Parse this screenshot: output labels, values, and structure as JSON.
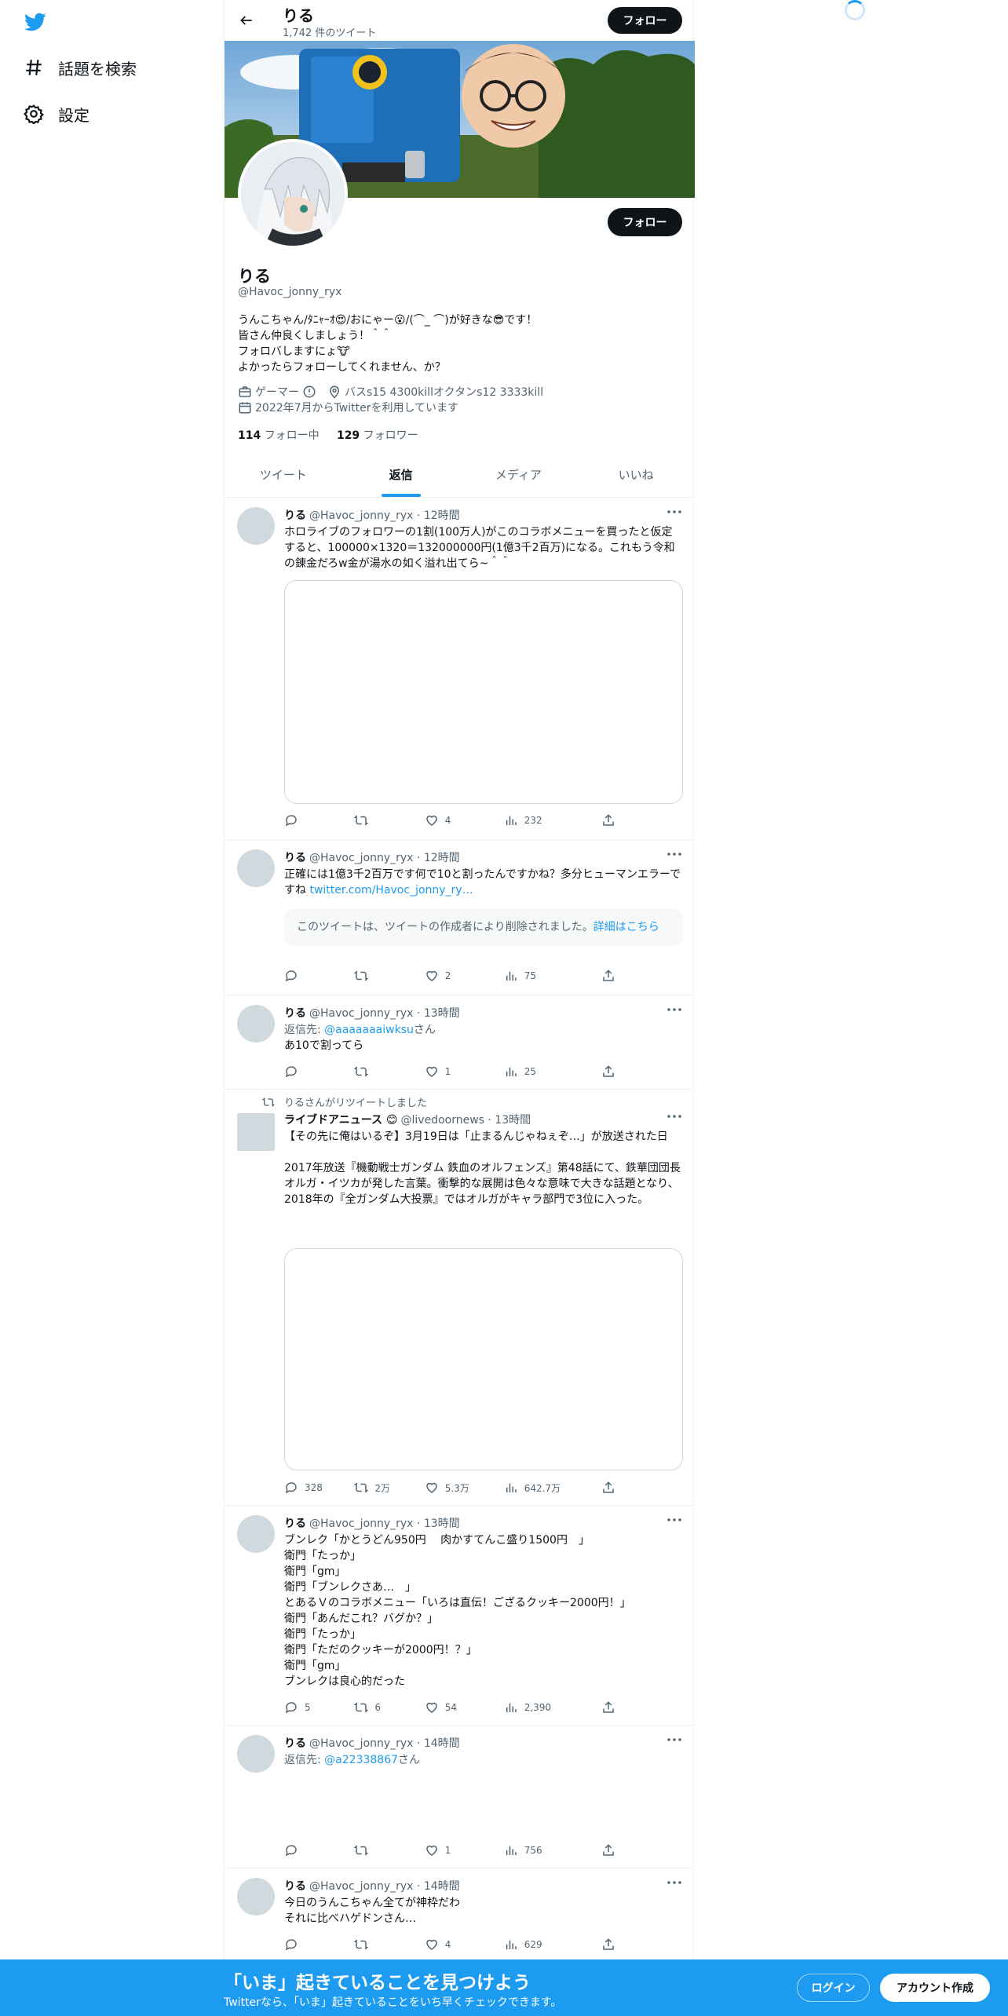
{
  "nav": {
    "logo_icon": "twitter-bird-icon",
    "explore_label": "話題を検索",
    "settings_label": "設定"
  },
  "header": {
    "name": "りる",
    "tweet_count": "1,742 件のツイート",
    "follow_label": "フォロー"
  },
  "profile": {
    "name": "りる",
    "handle": "@Havoc_jonny_ryx",
    "follow_label": "フォロー",
    "bio_lines": [
      "うんこちゃん/ﾀﾆｬｰｵ😍/おにゃー😮/(⌒_ ⌒)が好きな😎です！",
      "皆さん仲良くしましょう！＾＾",
      "フォロバしますにょ🐮",
      "よかったらフォローしてくれません、か？"
    ],
    "category": "ゲーマー",
    "location": "バスs15 4300killオクタンs12 3333kill",
    "joined": "2022年7月からTwitterを利用しています",
    "following_count": "114",
    "following_label": "フォロー中",
    "followers_count": "129",
    "followers_label": "フォロワー"
  },
  "tabs": [
    "ツイート",
    "返信",
    "メディア",
    "いいね"
  ],
  "active_tab": "返信",
  "tweets": [
    {
      "name": "りる",
      "handle": "@Havoc_jonny_ryx · 12時間",
      "text": "ホロライブのフォロワーの1割(100万人)がこのコラボメニューを買ったと仮定すると、100000×1320＝132000000円(1億3千2百万)になる。これもう令和の錬金だろw金が湯水の如く溢れ出てら~＾＾",
      "reply": "",
      "retweet": "",
      "like": "4",
      "views": "232"
    },
    {
      "name": "りる",
      "handle": "@Havoc_jonny_ryx · 12時間",
      "text": "正確には1億3千2百万です何で10と割ったんですかね？多分ヒューマンエラーですね ",
      "link": "twitter.com/Havoc_jonny_ry…",
      "deleted_text": "このツイートは、ツイートの作成者により削除されました。",
      "deleted_link": "詳細はこちら",
      "reply": "",
      "retweet": "",
      "like": "2",
      "views": "75"
    },
    {
      "name": "りる",
      "handle": "@Havoc_jonny_ryx · 13時間",
      "replying_prefix": "返信先: ",
      "replying_to": "@aaaaaaaiwksu",
      "replying_suffix": "さん",
      "text": "あ10で割ってら",
      "reply": "",
      "retweet": "",
      "like": "1",
      "views": "25"
    },
    {
      "retweeted_by": "りるさんがリツイートしました",
      "name": "ライブドアニュース 😊",
      "handle": "@livedoornews · 13時間",
      "text": "【その先に俺はいるぞ】3月19日は「止まるんじゃねぇぞ…」が放送された日\n\n2017年放送『機動戦士ガンダム 鉄血のオルフェンズ』第48話にて、鉄華団団長オルガ・イツカが発した言葉。衝撃的な展開は色々な意味で大きな話題となり、2018年の『全ガンダム大投票』ではオルガがキャラ部門で3位に入った。",
      "reply": "328",
      "retweet": "2万",
      "like": "5.3万",
      "views": "642.7万"
    },
    {
      "name": "りる",
      "handle": "@Havoc_jonny_ryx · 13時間",
      "text": "ブンレク「かとうどん950円　 肉かすてんこ盛り1500円　」\n衛門「たっか」\n衛門「gm」\n衛門「ブンレクさあ…　」\nとあるＶのコラボメニュー「いろは直伝！ござるクッキー2000円！」\n衛門「あんだこれ？バグか？」\n衛門「たっか」\n衛門「ただのクッキーが2000円！？」\n衛門「gm」\nブンレクは良心的だった",
      "reply": "5",
      "retweet": "6",
      "like": "54",
      "views": "2,390"
    },
    {
      "name": "りる",
      "handle": "@Havoc_jonny_ryx · 14時間",
      "replying_prefix": "返信先: ",
      "replying_to": "@a22338867",
      "replying_suffix": "さん",
      "text": "",
      "reply": "",
      "retweet": "",
      "like": "1",
      "views": "756"
    },
    {
      "name": "りる",
      "handle": "@Havoc_jonny_ryx · 14時間",
      "text": "今日のうんこちゃん全てが神枠だわ\nそれに比べハゲドンさん…",
      "reply": "",
      "retweet": "",
      "like": "4",
      "views": "629"
    }
  ],
  "bottom_bar": {
    "title": "「いま」起きていることを見つけよう",
    "subtitle": "Twitterなら、「いま」起きていることをいち早くチェックできます。",
    "login_label": "ログイン",
    "signup_label": "アカウント作成"
  },
  "colors": {
    "accent": "#1d9bf0",
    "text": "#0f1419",
    "muted": "#536471",
    "bottom_bar": "#1d9bf0"
  }
}
